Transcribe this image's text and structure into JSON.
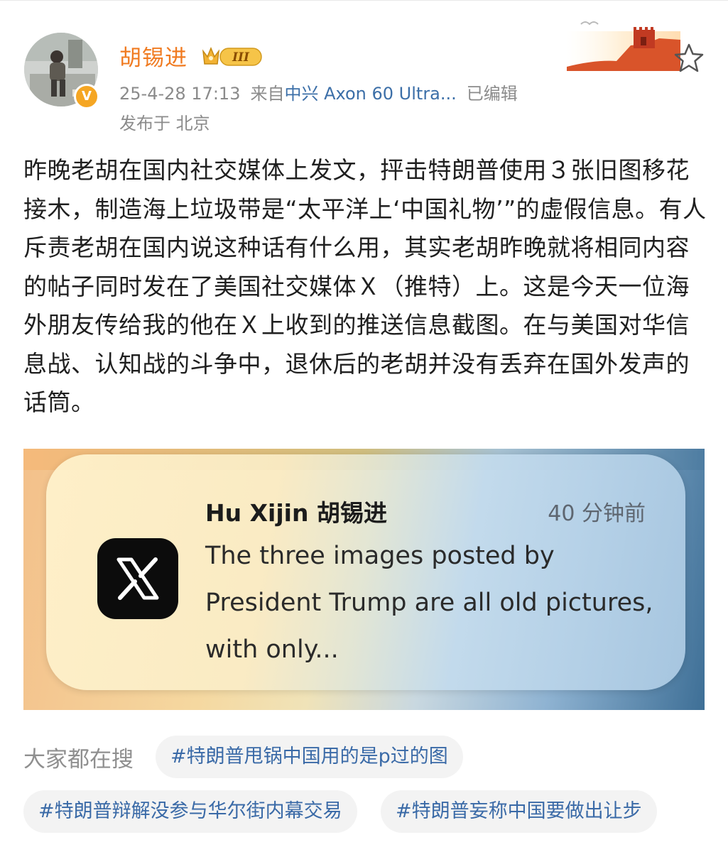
{
  "header": {
    "username": "胡锡进",
    "rank_badge": "III",
    "timestamp": "25-4-28 17:13",
    "source_prefix": "来自",
    "device": "中兴 Axon 60 Ultra...",
    "edited": "已编辑",
    "location": "发布于 北京",
    "verified_badge": "V"
  },
  "post": {
    "text": "昨晚老胡在国内社交媒体上发文，抨击特朗普使用３张旧图移花接木，制造海上垃圾带是“太平洋上‘中国礼物’”的虚假信息。有人斥责老胡在国内说这种话有什么用，其实老胡昨晚就将相同内容的帖子同时发在了美国社交媒体Ｘ（推特）上。这是今天一位海外朋友传给我的他在Ｘ上收到的推送信息截图。在与美国对华信息战、认知战的斗争中，退休后的老胡并没有丢弃在国外发声的话筒。"
  },
  "notification": {
    "app_icon": "x-logo-icon",
    "title": "Hu Xijin 胡锡进",
    "time": "40 分钟前",
    "body": "The three images posted by President Trump are all old pictures, with only..."
  },
  "searches": {
    "label": "大家都在搜",
    "tags": [
      "#特朗普甩锅中国用的是p过的图",
      "#特朗普辩解没参与华尔街内幕交易",
      "#特朗普妄称中国要做出让步"
    ]
  },
  "colors": {
    "username": "#f07b21",
    "link": "#3c6fa8",
    "meta": "#8b8b8b",
    "tag_bg": "#f3f3f3"
  }
}
